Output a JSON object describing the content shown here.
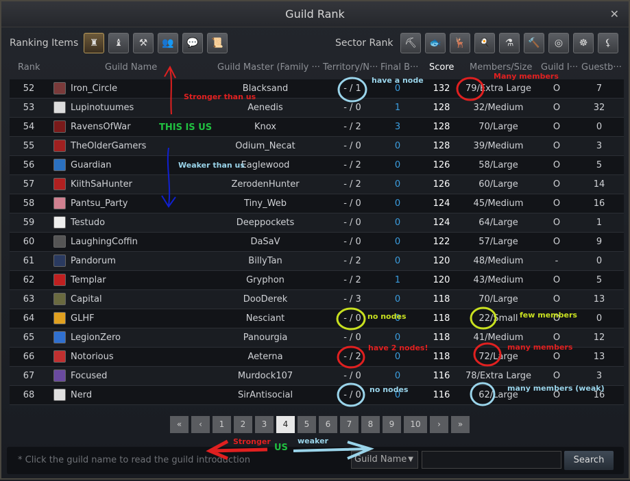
{
  "window": {
    "title": "Guild Rank",
    "close": "✕"
  },
  "toolbar": {
    "ranking_label": "Ranking Items",
    "sector_label": "Sector Rank",
    "ranking_icons": [
      "guild-crest",
      "tower",
      "crossed-axes",
      "members",
      "chat",
      "scroll"
    ],
    "ranking_glyphs": [
      "♜",
      "♝",
      "⚒",
      "👥",
      "💬",
      "📜"
    ],
    "sector_icons": [
      "pickaxe",
      "fish",
      "deer",
      "cooking",
      "alchemy",
      "hammer",
      "spiral",
      "wheel",
      "sickle"
    ],
    "sector_glyphs": [
      "⛏",
      "🐟",
      "🦌",
      "🍳",
      "⚗",
      "🔨",
      "◎",
      "☸",
      "⚸"
    ]
  },
  "columns": [
    "Rank",
    "Guild Name",
    "Guild Master (Family ···",
    "Territory/N···",
    "Final B···",
    "Score",
    "Members/Size",
    "Guild I···",
    "Guestb···"
  ],
  "rows": [
    {
      "rank": "52",
      "name": "Iron_Circle",
      "master": "Blacksand",
      "territory": "- / 1",
      "final": "0",
      "score": "132",
      "members": "79/Extra Large",
      "intro": "O",
      "guestbook": "7",
      "icon_color": "#7a3a3a"
    },
    {
      "rank": "53",
      "name": "Lupinotuumes",
      "master": "Aenedis",
      "territory": "- / 0",
      "final": "1",
      "score": "128",
      "members": "32/Medium",
      "intro": "O",
      "guestbook": "32",
      "icon_color": "#dddddd"
    },
    {
      "rank": "54",
      "name": "RavensOfWar",
      "master": "Knox",
      "territory": "- / 2",
      "final": "3",
      "score": "128",
      "members": "70/Large",
      "intro": "O",
      "guestbook": "0",
      "icon_color": "#7a1a1a"
    },
    {
      "rank": "55",
      "name": "TheOlderGamers",
      "master": "Odium_Necat",
      "territory": "- / 0",
      "final": "0",
      "score": "128",
      "members": "39/Medium",
      "intro": "O",
      "guestbook": "3",
      "icon_color": "#a02020"
    },
    {
      "rank": "56",
      "name": "Guardian",
      "master": "Eaglewood",
      "territory": "- / 2",
      "final": "0",
      "score": "126",
      "members": "58/Large",
      "intro": "O",
      "guestbook": "5",
      "icon_color": "#2a70c0"
    },
    {
      "rank": "57",
      "name": "KiithSaHunter",
      "master": "ZerodenHunter",
      "territory": "- / 2",
      "final": "0",
      "score": "126",
      "members": "60/Large",
      "intro": "O",
      "guestbook": "14",
      "icon_color": "#b02020"
    },
    {
      "rank": "58",
      "name": "Pantsu_Party",
      "master": "Tiny_Web",
      "territory": "- / 0",
      "final": "0",
      "score": "124",
      "members": "45/Medium",
      "intro": "O",
      "guestbook": "16",
      "icon_color": "#d08090"
    },
    {
      "rank": "59",
      "name": "Testudo",
      "master": "Deeppockets",
      "territory": "- / 0",
      "final": "0",
      "score": "124",
      "members": "64/Large",
      "intro": "O",
      "guestbook": "1",
      "icon_color": "#eeeeee"
    },
    {
      "rank": "60",
      "name": "LaughingCoffin",
      "master": "DaSaV",
      "territory": "- / 0",
      "final": "0",
      "score": "122",
      "members": "57/Large",
      "intro": "O",
      "guestbook": "9",
      "icon_color": "#555555"
    },
    {
      "rank": "61",
      "name": "Pandorum",
      "master": "BillyTan",
      "territory": "- / 2",
      "final": "0",
      "score": "120",
      "members": "48/Medium",
      "intro": "-",
      "guestbook": "0",
      "icon_color": "#2a3a60"
    },
    {
      "rank": "62",
      "name": "Templar",
      "master": "Gryphon",
      "territory": "- / 2",
      "final": "1",
      "score": "120",
      "members": "43/Medium",
      "intro": "O",
      "guestbook": "5",
      "icon_color": "#c02020"
    },
    {
      "rank": "63",
      "name": "Capital",
      "master": "DooDerek",
      "territory": "- / 3",
      "final": "0",
      "score": "118",
      "members": "70/Large",
      "intro": "O",
      "guestbook": "13",
      "icon_color": "#6a6a40"
    },
    {
      "rank": "64",
      "name": "GLHF",
      "master": "Nesciant",
      "territory": "- / 0",
      "final": "0",
      "score": "118",
      "members": "22/Small",
      "intro": "O",
      "guestbook": "0",
      "icon_color": "#e0a020"
    },
    {
      "rank": "65",
      "name": "LegionZero",
      "master": "Panourgia",
      "territory": "- / 0",
      "final": "0",
      "score": "118",
      "members": "41/Medium",
      "intro": "O",
      "guestbook": "12",
      "icon_color": "#3070d0"
    },
    {
      "rank": "66",
      "name": "Notorious",
      "master": "Aeterna",
      "territory": "- / 2",
      "final": "0",
      "score": "118",
      "members": "72/Large",
      "intro": "O",
      "guestbook": "13",
      "icon_color": "#c03030"
    },
    {
      "rank": "67",
      "name": "Focused",
      "master": "Murdock107",
      "territory": "- / 0",
      "final": "0",
      "score": "116",
      "members": "78/Extra Large",
      "intro": "O",
      "guestbook": "3",
      "icon_color": "#6a4aa0"
    },
    {
      "rank": "68",
      "name": "Nerd",
      "master": "SirAntisocial",
      "territory": "- / 0",
      "final": "0",
      "score": "116",
      "members": "62/Large",
      "intro": "O",
      "guestbook": "16",
      "icon_color": "#e0e0e0"
    }
  ],
  "pagination": {
    "first": "«",
    "prev": "‹",
    "pages": [
      "1",
      "2",
      "3",
      "4",
      "5",
      "6",
      "7",
      "8",
      "9",
      "10"
    ],
    "current": "4",
    "next": "›",
    "last": "»"
  },
  "footer": {
    "hint": "* Click the guild name to read the guild introduction",
    "search_type": "Guild Name",
    "search_value": "",
    "search_button": "Search"
  },
  "annotations": {
    "stronger_than_us": "Stronger than us",
    "this_is_us": "THIS IS US",
    "weaker_than_us": "Weaker than us",
    "have_a_node": "have a node",
    "many_members_1": "Many members",
    "no_nodes_1": "no nodes",
    "few_members": "few members",
    "have_2_nodes": "have 2 nodes!",
    "many_members_2": "many members",
    "no_nodes_2": "no nodes",
    "many_members_weak": "many members (weak)",
    "stronger": "Stronger",
    "us": "US",
    "weaker": "weaker"
  }
}
